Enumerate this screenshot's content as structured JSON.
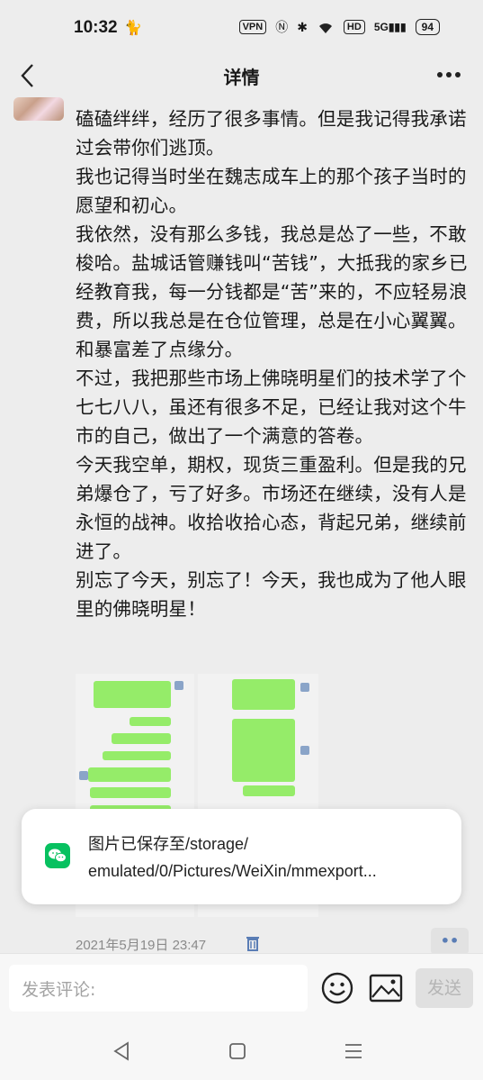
{
  "status": {
    "time": "10:32",
    "vpn": "VPN",
    "network": "5G",
    "hd": "HD",
    "battery": "94"
  },
  "nav": {
    "title": "详情"
  },
  "post": {
    "lines": [
      "磕磕绊绊，经历了很多事情。但是我记得我承诺过会带你们逃顶。",
      "我也记得当时坐在魏志成车上的那个孩子当时的愿望和初心。",
      "我依然，没有那么多钱，我总是怂了一些，不敢梭哈。盐城话管赚钱叫“苦钱”，大抵我的家乡已经教育我，每一分钱都是“苦”来的，不应轻易浪费，所以我总是在仓位管理，总是在小心翼翼。和暴富差了点缘分。",
      "不过，我把那些市场上佛晓明星们的技术学了个七七八八，虽还有很多不足，已经让我对这个牛市的自己，做出了一个满意的答卷。",
      "今天我空单，期权，现货三重盈利。但是我的兄弟爆仓了，亏了好多。市场还在继续，没有人是永恒的战神。收拾收拾心态，背起兄弟，继续前进了。",
      "别忘了今天，别忘了！今天，我也成为了他人眼里的佛晓明星！"
    ],
    "date": "2021年5月19日 23:47",
    "dots": "••"
  },
  "toast": {
    "line1": "图片已保存至/storage/",
    "line2": "emulated/0/Pictures/WeiXin/mmexport..."
  },
  "comment": {
    "placeholder": "发表评论:",
    "send_label": "发送"
  }
}
